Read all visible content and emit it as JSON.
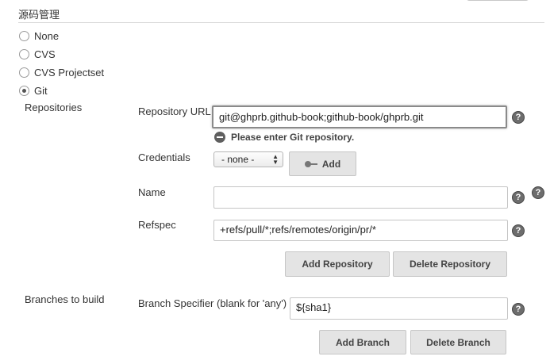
{
  "section": {
    "title": "源码管理"
  },
  "scm": {
    "options": [
      {
        "label": "None",
        "selected": false
      },
      {
        "label": "CVS",
        "selected": false
      },
      {
        "label": "CVS Projectset",
        "selected": false
      },
      {
        "label": "Git",
        "selected": true
      }
    ]
  },
  "repositories": {
    "label": "Repositories",
    "url_label": "Repository URL",
    "url_value": "git@ghprb.github-book;github-book/ghprb.git",
    "error": "Please enter Git repository.",
    "credentials_label": "Credentials",
    "credentials_value": "- none -",
    "add_label": "Add",
    "name_label": "Name",
    "name_value": "",
    "refspec_label": "Refspec",
    "refspec_value": "+refs/pull/*;refs/remotes/origin/pr/*",
    "add_repo_label": "Add Repository",
    "delete_repo_label": "Delete Repository"
  },
  "branches": {
    "label": "Branches to build",
    "specifier_label": "Branch Specifier (blank for 'any')",
    "specifier_value": "${sha1}",
    "add_branch_label": "Add Branch",
    "delete_branch_label": "Delete Branch"
  },
  "help": {
    "glyph": "?"
  }
}
